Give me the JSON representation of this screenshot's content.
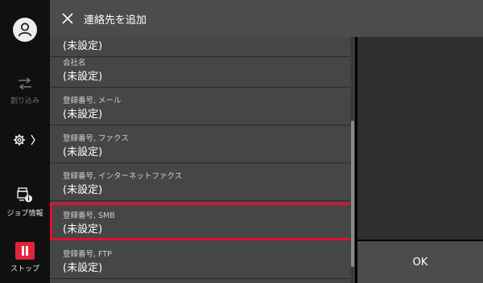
{
  "header": {
    "title": "連絡先を追加"
  },
  "rail": {
    "interrupt_label": "割り込み",
    "job_status_label": "ジョブ情報",
    "stop_label": "ストップ"
  },
  "list": {
    "top_partial_value": "(未設定)",
    "rows": [
      {
        "label": "会社名",
        "value": "(未設定)"
      },
      {
        "label": "登録番号, メール",
        "value": "(未設定)"
      },
      {
        "label": "登録番号, ファクス",
        "value": "(未設定)"
      },
      {
        "label": "登録番号, インターネットファクス",
        "value": "(未設定)"
      },
      {
        "label": "登録番号, SMB",
        "value": "(未設定)"
      },
      {
        "label": "登録番号, FTP",
        "value": "(未設定)"
      }
    ]
  },
  "actions": {
    "ok_label": "OK"
  },
  "colors": {
    "highlight": "#e0112b",
    "stop": "#e0243a"
  }
}
